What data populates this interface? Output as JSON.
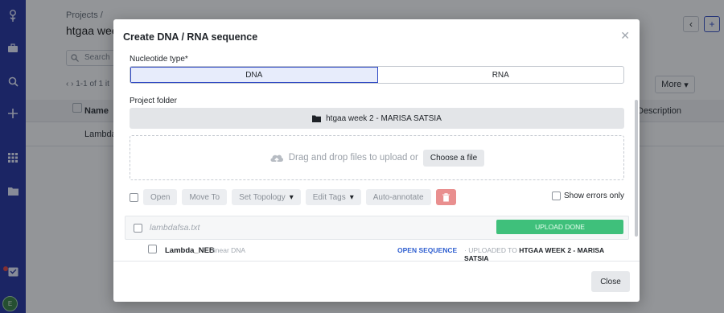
{
  "background": {
    "breadcrumb": "Projects /",
    "page_title": "htgaa wee",
    "search_placeholder": "Search",
    "pager_text": "1-1 of 1 it",
    "table_header_name": "Name",
    "table_header_description": "Description",
    "row_name": "Lambda",
    "more_label": "More",
    "avatar_initial": "E"
  },
  "modal": {
    "title": "Create DNA / RNA sequence",
    "nucleotide_label": "Nucleotide type*",
    "options": [
      "DNA",
      "RNA"
    ],
    "selected": "DNA",
    "project_folder_label": "Project folder",
    "project_folder_value": "htgaa week 2 - MARISA SATSIA",
    "drop_text": "Drag and drop files to upload or",
    "choose_file": "Choose a file",
    "toolbar": {
      "open": "Open",
      "move_to": "Move To",
      "set_topology": "Set Topology",
      "edit_tags": "Edit Tags",
      "auto_annotate": "Auto-annotate",
      "show_errors": "Show errors only"
    },
    "file": {
      "name": "lambdafsa.txt",
      "status": "UPLOAD DONE"
    },
    "sequence": {
      "name": "Lambda_NEB",
      "type": "linear DNA",
      "open": "OPEN SEQUENCE",
      "uploaded_prefix": "UPLOADED TO",
      "uploaded_target": "HTGAA WEEK 2 - MARISA SATSIA"
    },
    "close_button": "Close",
    "colors": {
      "rail": "#1a2a9c",
      "accent": "#2f49c4",
      "success": "#3fc07b",
      "danger": "#e98f8f"
    }
  }
}
